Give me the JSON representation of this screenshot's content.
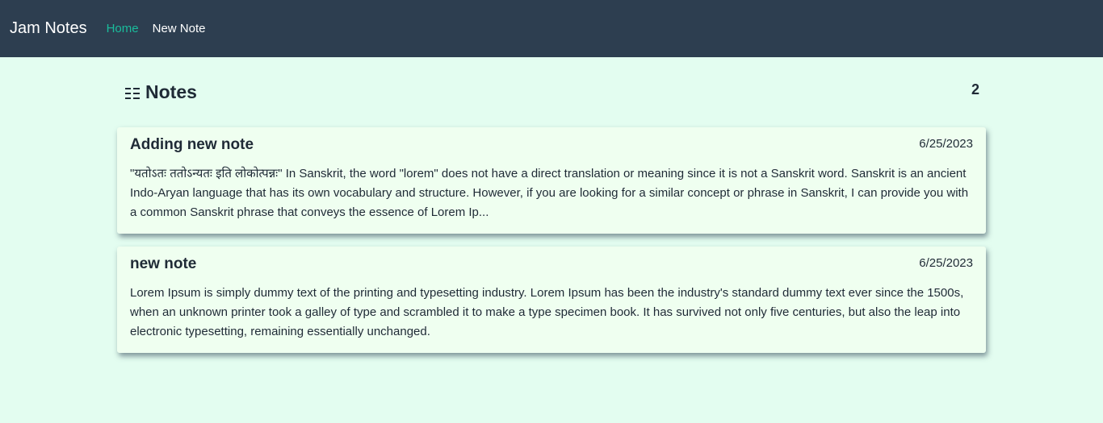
{
  "nav": {
    "brand": "Jam Notes",
    "links": [
      {
        "label": "Home",
        "active": true
      },
      {
        "label": "New Note",
        "active": false
      }
    ],
    "colors": {
      "background": "#2d3e50",
      "active": "#1abc9c"
    }
  },
  "page": {
    "title": "Notes",
    "title_icon": "list-icon",
    "count": "2"
  },
  "notes": [
    {
      "title": "Adding new note",
      "date": "6/25/2023",
      "body": "\"यतोऽतः ततोऽन्यतः इति लोकोत्पन्नः\" In Sanskrit, the word \"lorem\" does not have a direct translation or meaning since it is not a Sanskrit word. Sanskrit is an ancient Indo-Aryan language that has its own vocabulary and structure. However, if you are looking for a similar concept or phrase in Sanskrit, I can provide you with a common Sanskrit phrase that conveys the essence of Lorem Ip..."
    },
    {
      "title": "new note",
      "date": "6/25/2023",
      "body": "Lorem Ipsum is simply dummy text of the printing and typesetting industry. Lorem Ipsum has been the industry's standard dummy text ever since the 1500s, when an unknown printer took a galley of type and scrambled it to make a type specimen book. It has survived not only five centuries, but also the leap into electronic typesetting, remaining essentially unchanged."
    }
  ]
}
